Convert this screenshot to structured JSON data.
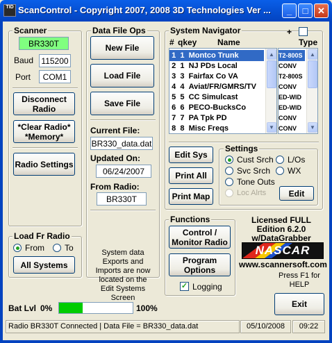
{
  "window": {
    "title": "ScanControl - Copyright 2007, 2008 3D Technologies  Ver ...",
    "icon_text": "TID"
  },
  "scanner": {
    "group_label": "Scanner",
    "model": "BR330T",
    "baud_label": "Baud",
    "baud": "115200",
    "port_label": "Port",
    "port": "COM1",
    "disconnect_label": "Disconnect Radio",
    "clear_label": "*Clear Radio* *Memory*",
    "settings_label": "Radio Settings"
  },
  "load_fr_radio": {
    "group_label": "Load Fr Radio",
    "from_label": "From",
    "to_label": "To",
    "selected": "From",
    "all_systems_label": "All Systems"
  },
  "data_file_ops": {
    "group_label": "Data File Ops",
    "new_label": "New File",
    "load_label": "Load File",
    "save_label": "Save File",
    "current_file_label": "Current File:",
    "current_file": "BR330_data.dat",
    "updated_on_label": "Updated On:",
    "updated_on": "06/24/2007",
    "from_radio_label": "From Radio:",
    "from_radio": "BR330T",
    "info_text": "System data Exports and Imports are now located on the Edit Systems Screen"
  },
  "system_navigator": {
    "group_label": "System Navigator",
    "plus_label": "+",
    "col_hash": "#",
    "col_qkey": "qkey",
    "col_name": "Name",
    "col_type": "Type",
    "rows": [
      {
        "num": "1",
        "qkey": "1",
        "name": "Montco Trunk",
        "type": "T2-800S",
        "selected": true
      },
      {
        "num": "2",
        "qkey": "1",
        "name": "NJ PDs Local",
        "type": "CONV",
        "selected": false
      },
      {
        "num": "3",
        "qkey": "3",
        "name": "Fairfax Co VA",
        "type": "T2-800S",
        "selected": false
      },
      {
        "num": "4",
        "qkey": "4",
        "name": "Aviat/FR/GMRS/TV",
        "type": "CONV",
        "selected": false
      },
      {
        "num": "5",
        "qkey": "5",
        "name": "CC Simulcast",
        "type": "ED-WID",
        "selected": false
      },
      {
        "num": "6",
        "qkey": "6",
        "name": "PECO-BucksCo",
        "type": "ED-WID",
        "selected": false
      },
      {
        "num": "7",
        "qkey": "7",
        "name": "PA Tpk PD",
        "type": "CONV",
        "selected": false
      },
      {
        "num": "8",
        "qkey": "8",
        "name": "Misc Freqs",
        "type": "CONV",
        "selected": false
      }
    ],
    "edit_sys_label": "Edit Sys",
    "print_all_label": "Print All",
    "print_map_label": "Print Map"
  },
  "settings": {
    "group_label": "Settings",
    "options": [
      {
        "label": "Cust Srch",
        "checked": true,
        "enabled": true
      },
      {
        "label": "L/Os",
        "checked": false,
        "enabled": true
      },
      {
        "label": "Svc Srch",
        "checked": false,
        "enabled": true
      },
      {
        "label": "WX",
        "checked": false,
        "enabled": true
      },
      {
        "label": "Tone Outs",
        "checked": false,
        "enabled": true
      },
      {
        "label": "Loc Alrts",
        "checked": false,
        "enabled": false
      }
    ],
    "edit_label": "Edit"
  },
  "functions": {
    "group_label": "Functions",
    "control_label": "Control / Monitor Radio",
    "program_label": "Program Options",
    "logging_label": "Logging",
    "logging_checked": true
  },
  "license": {
    "line1": "Licensed FULL",
    "line2": "Edition 6.2.0",
    "line3": "w/DataGrabber",
    "logo_text": "NASCAR",
    "website": "www.scannersoft.com",
    "help_text": "Press F1 for HELP",
    "exit_label": "Exit"
  },
  "battery": {
    "label": "Bat Lvl",
    "min_label": "0%",
    "max_label": "100%",
    "level_percent": 32
  },
  "statusbar": {
    "message": "Radio BR330T Connected | Data File = BR330_data.dat",
    "date": "05/10/2008",
    "time": "09:22"
  },
  "colors": {
    "titlebar": "#0343C0",
    "selection": "#316AC5",
    "model_field": "#80FF80",
    "battery_fill": "#00CC00"
  }
}
